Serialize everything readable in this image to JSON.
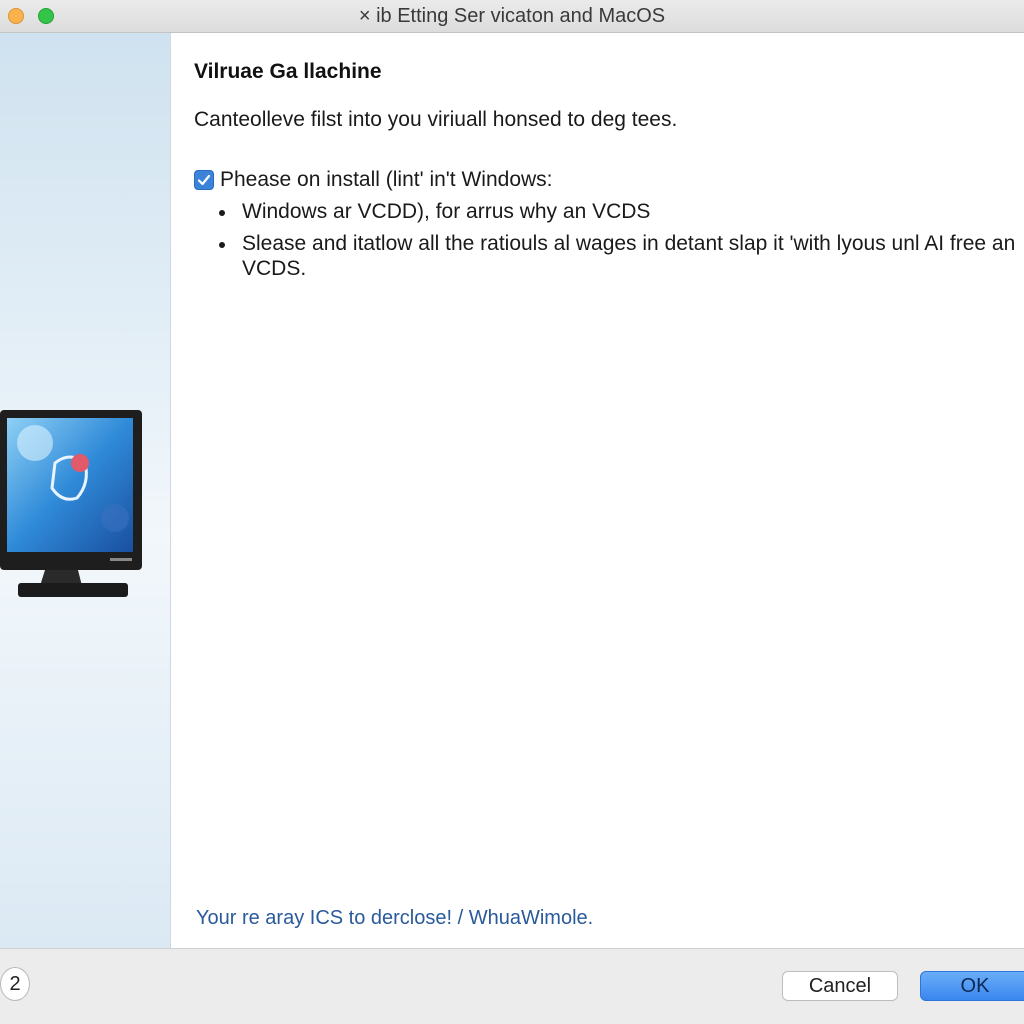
{
  "window": {
    "title": "× ib Etting Ser vicaton and MacOS"
  },
  "content": {
    "heading": "Vilruae Ga llachine",
    "intro": "Canteolleve filst into you viriuall honsed to deg tees.",
    "checkbox_label": "Phease on install (lint' in't Windows:",
    "checkbox_checked": true,
    "bullets": [
      "Windows ar VCDD), for arrus why an VCDS",
      "Slease and itatlow all the ratiouls al wages in detant slap it 'with lyous unl AI free an VCDS."
    ],
    "footer_link": "Your re aray ICS to derclose! / WhuaWimole."
  },
  "bottombar": {
    "help_label": "2",
    "cancel_label": "Cancel",
    "ok_label": "OK"
  },
  "colors": {
    "accent": "#3b82d9",
    "ok_button": "#3a86f0",
    "link": "#2a5a9a"
  }
}
